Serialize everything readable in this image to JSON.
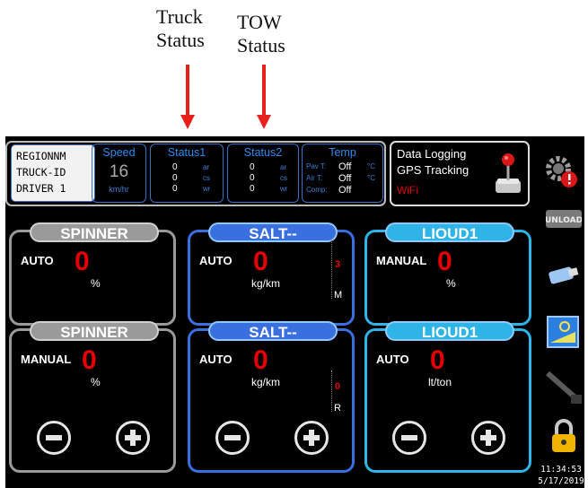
{
  "annotations": {
    "truck": [
      "Truck",
      "Status"
    ],
    "tow": [
      "TOW",
      "Status"
    ]
  },
  "header": {
    "id_lines": [
      "REGIONNM",
      "TRUCK-ID",
      "DRIVER 1"
    ],
    "speed": {
      "title": "Speed",
      "value": "16",
      "unit": "km/hr"
    },
    "status1": {
      "title": "Status1",
      "rows": [
        [
          "0",
          "ar"
        ],
        [
          "0",
          "cs"
        ],
        [
          "0",
          "wr"
        ]
      ]
    },
    "status2": {
      "title": "Status2",
      "rows": [
        [
          "0",
          "ar"
        ],
        [
          "0",
          "cs"
        ],
        [
          "0",
          "wr"
        ]
      ]
    },
    "temp": {
      "title": "Temp",
      "rows": [
        [
          "Pav T:",
          "Off",
          "°C"
        ],
        [
          "Air T:",
          "Off",
          "°C"
        ],
        [
          "Comp:",
          "Off",
          ""
        ]
      ]
    },
    "logging": {
      "line1": "Data Logging",
      "line2": "GPS Tracking",
      "wifi": "WiFi"
    }
  },
  "cards": [
    {
      "title": "SPINNER",
      "mode": "AUTO",
      "value": "0",
      "unit": "%",
      "gauge": ""
    },
    {
      "title": "SALT--",
      "mode": "AUTO",
      "value": "0",
      "unit": "kg/km",
      "gauge": "3",
      "gauge_label": "M"
    },
    {
      "title": "LIOUD1",
      "mode": "MANUAL",
      "value": "0",
      "unit": "%",
      "gauge": ""
    },
    {
      "title": "SPINNER",
      "mode": "MANUAL",
      "value": "0",
      "unit": "%",
      "gauge": ""
    },
    {
      "title": "SALT--",
      "mode": "AUTO",
      "value": "0",
      "unit": "kg/km",
      "gauge": "0",
      "gauge_label": "R"
    },
    {
      "title": "LIOUD1",
      "mode": "AUTO",
      "value": "0",
      "unit": "lt/ton",
      "gauge": ""
    }
  ],
  "sidebar": {
    "unload_label": "UNLOAD",
    "time": "11:34:53",
    "date": "5/17/2019"
  },
  "colors": {
    "grey": "#9a9a9a",
    "blue": "#3a6fe0",
    "cyan": "#2fb4e8",
    "red": "#e60000"
  }
}
